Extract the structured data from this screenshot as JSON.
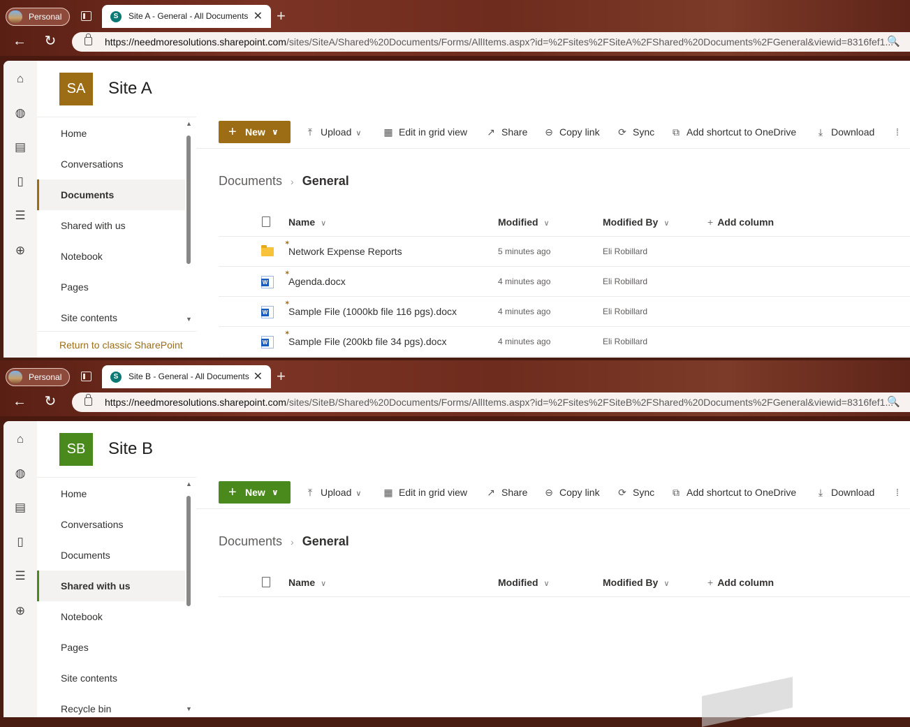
{
  "windows": [
    {
      "profile": "Personal",
      "tab_title": "Site A - General - All Documents",
      "url_host": "https://needmoresolutions.sharepoint.com",
      "url_path": "/sites/SiteA/Shared%20Documents/Forms/AllItems.aspx?id=%2Fsites%2FSiteA%2FShared%20Documents%2FGeneral&viewid=8316fef1...",
      "site_initials": "SA",
      "site_title": "Site A",
      "accent": "#9c6d15",
      "nav": [
        "Home",
        "Conversations",
        "Documents",
        "Shared with us",
        "Notebook",
        "Pages",
        "Site contents"
      ],
      "selected_nav": "Documents",
      "classic_link": "Return to classic SharePoint",
      "commands": {
        "new": "New",
        "upload": "Upload",
        "grid": "Edit in grid view",
        "share": "Share",
        "copy": "Copy link",
        "sync": "Sync",
        "shortcut": "Add shortcut to OneDrive",
        "download": "Download"
      },
      "breadcrumb": [
        "Documents",
        "General"
      ],
      "columns": {
        "name": "Name",
        "modified": "Modified",
        "modified_by": "Modified By",
        "add": "Add column"
      },
      "files": [
        {
          "name": "Network Expense Reports",
          "type": "folder",
          "modified": "5 minutes ago",
          "by": "Eli Robillard"
        },
        {
          "name": "Agenda.docx",
          "type": "word",
          "modified": "4 minutes ago",
          "by": "Eli Robillard"
        },
        {
          "name": "Sample File (1000kb file 116 pgs).docx",
          "type": "word",
          "modified": "4 minutes ago",
          "by": "Eli Robillard"
        },
        {
          "name": "Sample File (200kb file 34 pgs).docx",
          "type": "word",
          "modified": "4 minutes ago",
          "by": "Eli Robillard"
        }
      ]
    },
    {
      "profile": "Personal",
      "tab_title": "Site B - General - All Documents",
      "url_host": "https://needmoresolutions.sharepoint.com",
      "url_path": "/sites/SiteB/Shared%20Documents/Forms/AllItems.aspx?id=%2Fsites%2FSiteB%2FShared%20Documents%2FGeneral&viewid=8316fef1...",
      "site_initials": "SB",
      "site_title": "Site B",
      "accent": "#4a8a1c",
      "nav": [
        "Home",
        "Conversations",
        "Documents",
        "Shared with us",
        "Notebook",
        "Pages",
        "Site contents",
        "Recycle bin"
      ],
      "selected_nav": "Shared with us",
      "commands": {
        "new": "New",
        "upload": "Upload",
        "grid": "Edit in grid view",
        "share": "Share",
        "copy": "Copy link",
        "sync": "Sync",
        "shortcut": "Add shortcut to OneDrive",
        "download": "Download"
      },
      "breadcrumb": [
        "Documents",
        "General"
      ],
      "columns": {
        "name": "Name",
        "modified": "Modified",
        "modified_by": "Modified By",
        "add": "Add column"
      },
      "files": []
    }
  ]
}
